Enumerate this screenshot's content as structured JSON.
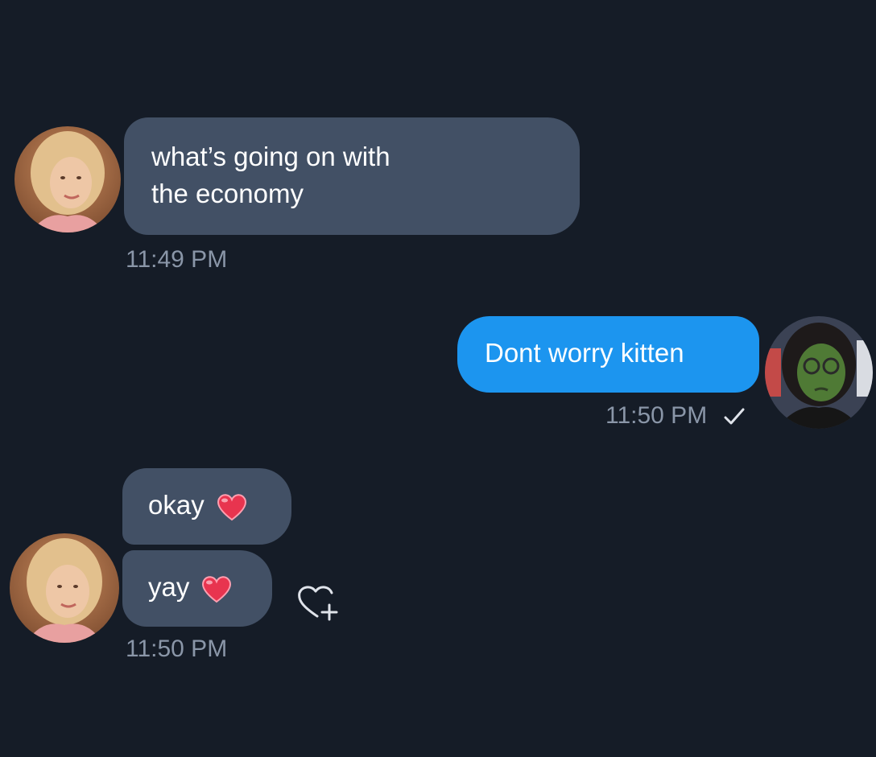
{
  "colors": {
    "background": "#151c27",
    "incoming_bubble": "#425065",
    "outgoing_bubble": "#1c95ef",
    "timestamp": "#8a96a8",
    "heart": "#e8344f"
  },
  "messages": [
    {
      "direction": "incoming",
      "lines": [
        "what’s going on with",
        "the economy"
      ],
      "time": "11:49 PM",
      "avatar_icon": "contact-avatar-blonde-icon"
    },
    {
      "direction": "outgoing",
      "text": "Dont worry kitten",
      "time": "11:50 PM",
      "status_icon": "check-icon",
      "avatar_icon": "own-avatar-green-icon"
    },
    {
      "direction": "incoming",
      "text": "okay",
      "emoji_icon": "red-heart-icon"
    },
    {
      "direction": "incoming",
      "text": "yay",
      "emoji_icon": "red-heart-icon",
      "reaction_icon": "add-reaction-heart-icon",
      "time": "11:50 PM",
      "avatar_icon": "contact-avatar-blonde-icon"
    }
  ]
}
